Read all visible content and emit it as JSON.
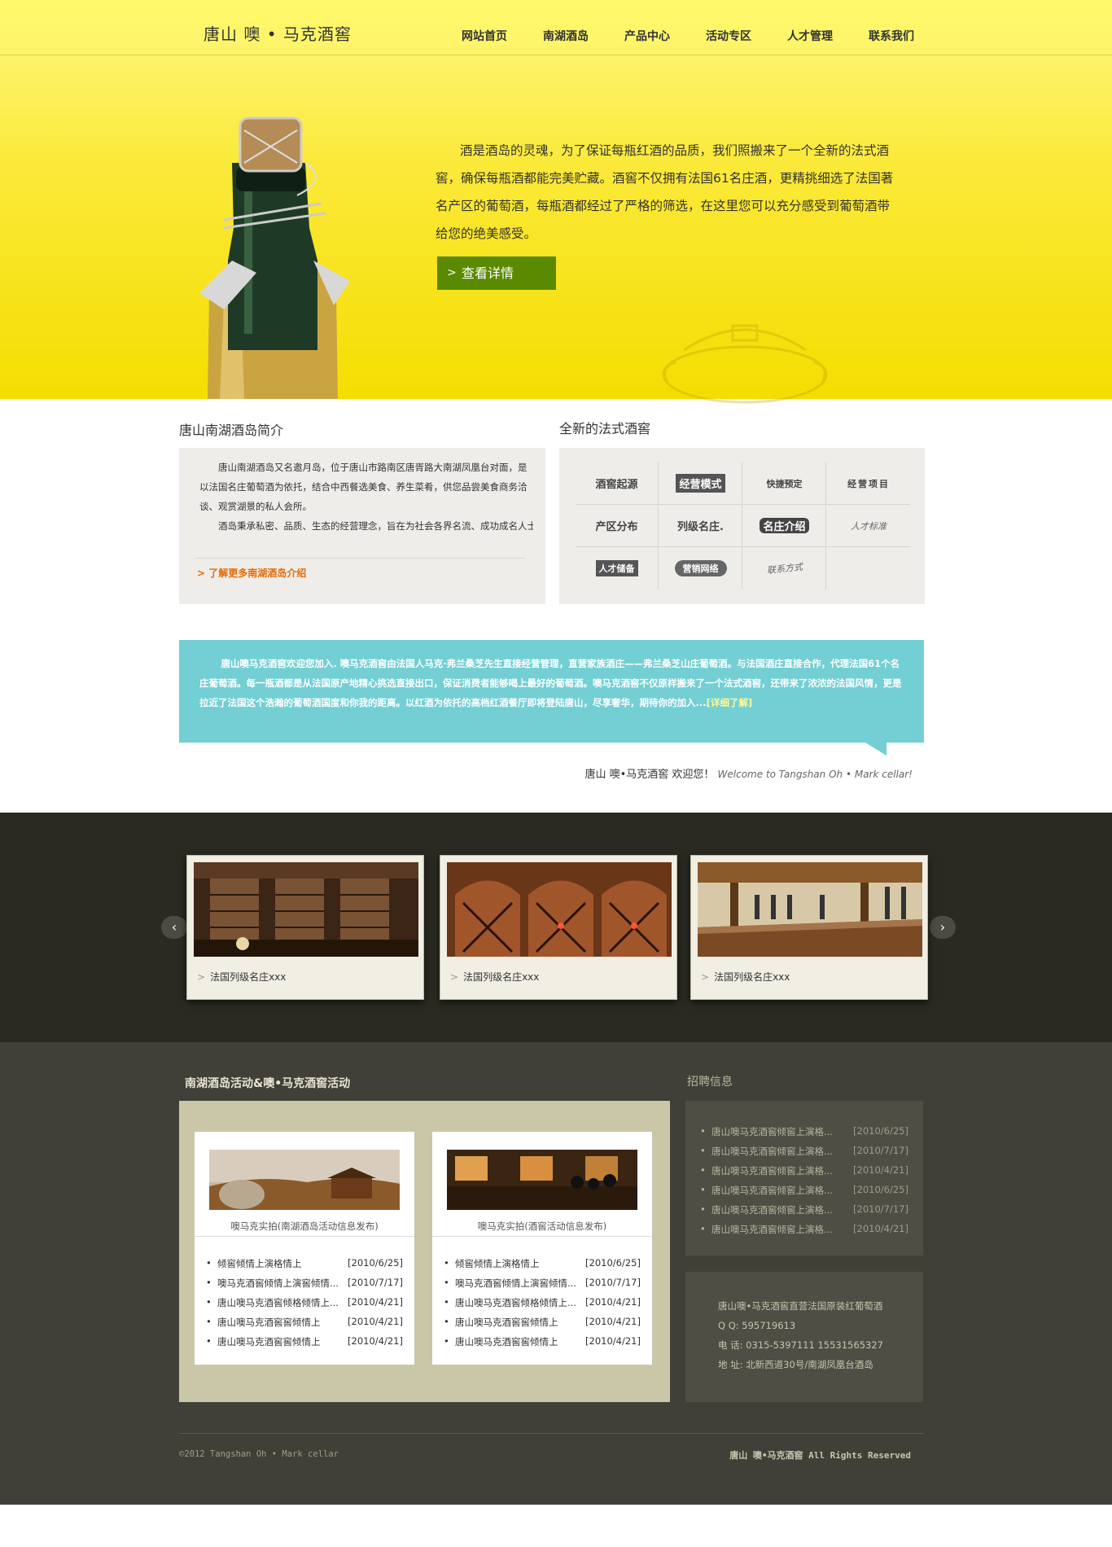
{
  "header": {
    "logo": "唐山 噢 • 马克酒窖",
    "nav": [
      "网站首页",
      "南湖酒岛",
      "产品中心",
      "活动专区",
      "人才管理",
      "联系我们"
    ]
  },
  "hero": {
    "text": "酒是酒岛的灵魂，为了保证每瓶红酒的品质，我们照搬来了一个全新的法式酒窖，确保每瓶酒都能完美贮藏。酒窖不仅拥有法国61名庄酒，更精挑细选了法国著名产区的葡萄酒，每瓶酒都经过了严格的筛选，在这里您可以充分感受到葡萄酒带给您的绝美感受。",
    "button": "查看详情",
    "button_arrow": ">"
  },
  "intro": {
    "title": "唐山南湖酒岛简介",
    "p1": "唐山南湖酒岛又名邀月岛，位于唐山市路南区唐胥路大南湖凤凰台对面，是以法国名庄葡萄酒为依托，结合中西餐选美食、养生菜肴，供您品尝美食商务洽谈、观赏湖景的私人会所。",
    "p2": "酒岛秉承私密、品质、生态的经营理念，旨在为社会各界名流、成功成名人士、政府官员、商界精英打造一个全新、健康、时尚、高雅、尊贵的私密",
    "more": "> 了解更多南湖酒岛介绍"
  },
  "cellar": {
    "title": "全新的法式酒窖",
    "items": [
      "酒窖起源",
      "经营模式",
      "快捷预定",
      "经营项目",
      "产区分布",
      "列级名庄.",
      "名庄介绍",
      "人才标准",
      "人才储备",
      "营销网络",
      "联系方式"
    ]
  },
  "teal": {
    "text": "唐山噢马克酒窖欢迎您加入.  噢马克酒窖由法国人马克·弗兰桑芝先生直接经营管理，直营家族酒庄——弗兰桑芝山庄葡萄酒。与法国酒庄直接合作，代理法国61个名庄葡萄酒。每一瓶酒都是从法国原产地精心挑选直接出口，保证消费者能够喝上最好的葡萄酒。噢马克酒窖不仅原样搬来了一个法式酒窖，还带来了浓浓的法国风情，更是拉近了法国这个浩瀚的葡萄酒国度和你我的距离。以红酒为依托的高档红酒餐厅即将登陆唐山，尽享奢华，期待你的加入...",
    "more": "[详细了解]"
  },
  "welcome": {
    "cn": "唐山 噢•马克酒窖 欢迎您！",
    "en": "Welcome to Tangshan Oh • Mark cellar!"
  },
  "gallery": {
    "prev": "‹",
    "next": "›",
    "items": [
      {
        "caption": "法国列级名庄xxx",
        "arrow": ">"
      },
      {
        "caption": "法国列级名庄xxx",
        "arrow": ">"
      },
      {
        "caption": "法国列级名庄xxx",
        "arrow": ">"
      }
    ]
  },
  "activities": {
    "title": "南湖酒岛活动&噢•马克酒窖活动",
    "cards": [
      {
        "caption": "噢马克实拍(南湖酒岛活动信息发布)",
        "rows": [
          {
            "t": "倾窖倾情上演格情上",
            "d": "[2010/6/25]"
          },
          {
            "t": "噢马克酒窖倾情上演窖倾情...",
            "d": "[2010/7/17]"
          },
          {
            "t": "唐山噢马克酒窖倾格倾情上...",
            "d": "[2010/4/21]"
          },
          {
            "t": "唐山噢马克酒窖窖倾情上",
            "d": "[2010/4/21]"
          },
          {
            "t": "唐山噢马克酒窖窖倾情上",
            "d": "[2010/4/21]"
          }
        ]
      },
      {
        "caption": "噢马克实拍(酒窖活动信息发布)",
        "rows": [
          {
            "t": "倾窖倾情上演格情上",
            "d": "[2010/6/25]"
          },
          {
            "t": "噢马克酒窖倾情上演窖倾情...",
            "d": "[2010/7/17]"
          },
          {
            "t": "唐山噢马克酒窖倾格倾情上...",
            "d": "[2010/4/21]"
          },
          {
            "t": "唐山噢马克酒窖窖倾情上",
            "d": "[2010/4/21]"
          },
          {
            "t": "唐山噢马克酒窖窖倾情上",
            "d": "[2010/4/21]"
          }
        ]
      }
    ]
  },
  "jobs": {
    "title": "招聘信息",
    "rows": [
      {
        "t": "唐山噢马克酒窖倾窖上演格...",
        "d": "[2010/6/25]"
      },
      {
        "t": "唐山噢马克酒窖倾窖上演格...",
        "d": "[2010/7/17]"
      },
      {
        "t": "唐山噢马克酒窖倾窖上演格...",
        "d": "[2010/4/21]"
      },
      {
        "t": "唐山噢马克酒窖倾窖上演格...",
        "d": "[2010/6/25]"
      },
      {
        "t": "唐山噢马克酒窖倾窖上演格...",
        "d": "[2010/7/17]"
      },
      {
        "t": "唐山噢马克酒窖倾窖上演格...",
        "d": "[2010/4/21]"
      }
    ]
  },
  "contact": {
    "line1": "唐山噢•马克酒窖直营法国原装红葡萄酒",
    "qq": "Q   Q:   595719613",
    "tel": "电  话:   0315-5397111   15531565327",
    "addr": "地  址:   北新西道30号/南湖凤凰台酒岛"
  },
  "footer": {
    "copy": "©2012 Tangshan Oh • Mark cellar",
    "rights": "唐山 噢•马克酒窖 All Rights Reserved"
  },
  "colors": {
    "hero": "#f4de00",
    "teal": "#73cfd4",
    "button": "#5a8a00",
    "dark": "#2a2a22",
    "bottom": "#414038"
  }
}
